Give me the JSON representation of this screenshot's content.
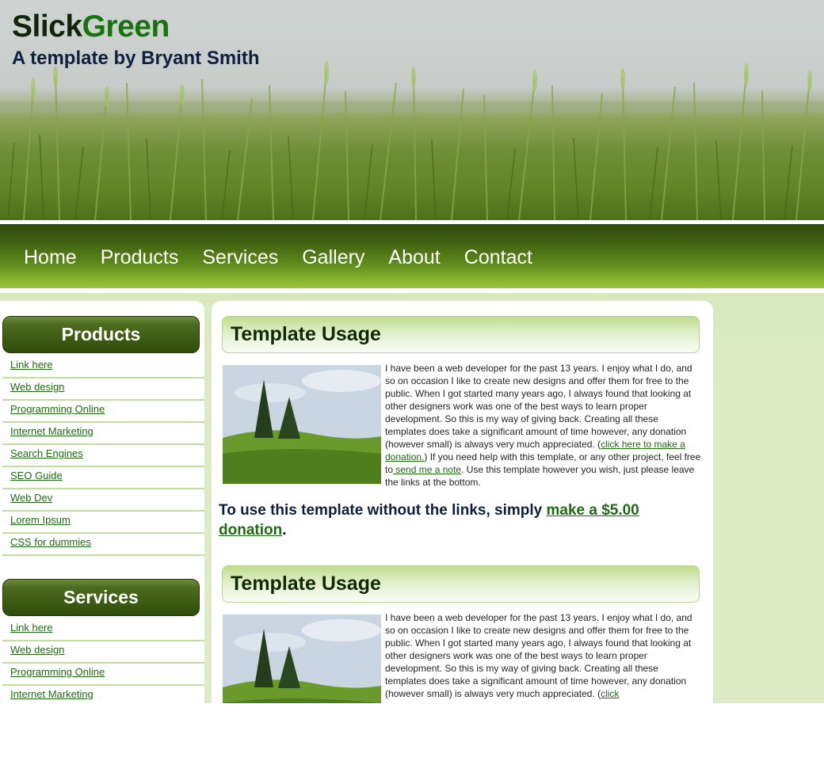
{
  "header": {
    "title_part1": "Slick",
    "title_part2": "Green",
    "subtitle": "A template by Bryant Smith"
  },
  "nav": {
    "items": [
      "Home",
      "Products",
      "Services",
      "Gallery",
      "About",
      "Contact"
    ]
  },
  "sidebar": {
    "products": {
      "heading": "Products",
      "links": [
        "Link here",
        "Web design",
        "Programming Online",
        "Internet Marketing",
        "Search Engines",
        "SEO Guide",
        "Web Dev",
        "Lorem Ipsum",
        "CSS for dummies"
      ]
    },
    "services": {
      "heading": "Services",
      "links": [
        "Link here",
        "Web design",
        "Programming Online",
        "Internet Marketing"
      ]
    }
  },
  "content": {
    "sections": [
      {
        "heading": "Template Usage",
        "para_text1": "I have been a web developer for the past 13 years. I enjoy what I do, and so on occasion I like to create new designs and offer them for free to the public. When I got started many years ago, I always found that looking at other designers work was one of the best ways to learn proper development. So this is my way of giving back. Creating all these templates does take a significant amount of time however, any donation (however small) is always very much appreciated. (",
        "para_link1": "click here to make a donation.",
        "para_text2": ") If you need help with this template, or any other project, feel free to",
        "para_link2": " send me a note",
        "para_text3": ". Use this template however you wish, just please leave the links at the bottom."
      },
      {
        "heading": "Template Usage",
        "para_text1": "I have been a web developer for the past 13 years. I enjoy what I do, and so on occasion I like to create new designs and offer them for free to the public. When I got started many years ago, I always found that looking at other designers work was one of the best ways to learn proper development. So this is my way of giving back. Creating all these templates does take a significant amount of time however, any donation (however small) is always very much appreciated. (",
        "para_link1": "click"
      }
    ],
    "notice_text": "To use this template without the links, simply ",
    "notice_link": "make a $5.00 donation",
    "notice_end": "."
  },
  "colors": {
    "brand_green": "#17720f",
    "nav_dark": "#2f4a09",
    "link_green": "#1f6b12"
  }
}
